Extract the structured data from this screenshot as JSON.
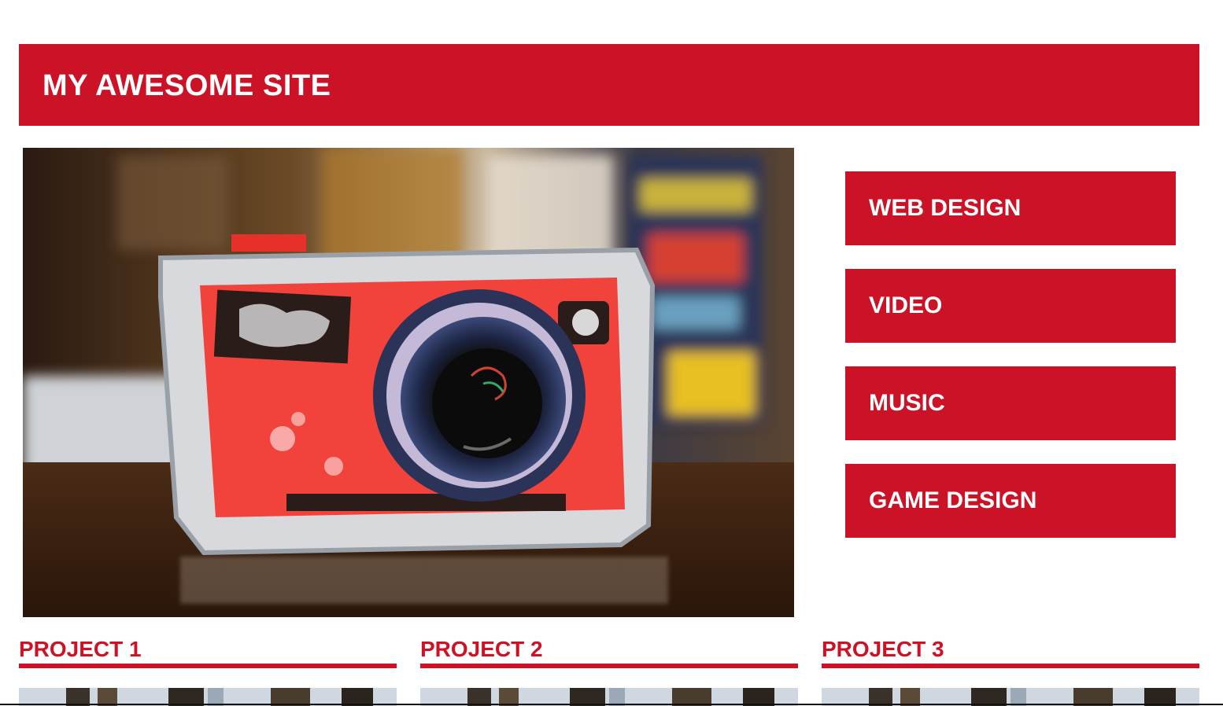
{
  "site": {
    "title": "MY AWESOME SITE"
  },
  "hero_image": {
    "alt": "Handmade red camera sculpture on a wooden table"
  },
  "nav": {
    "items": [
      {
        "label": "WEB DESIGN"
      },
      {
        "label": "VIDEO"
      },
      {
        "label": "MUSIC"
      },
      {
        "label": "GAME DESIGN"
      }
    ]
  },
  "projects": [
    {
      "title": "PROJECT 1"
    },
    {
      "title": "PROJECT 2"
    },
    {
      "title": "PROJECT 3"
    }
  ],
  "colors": {
    "brand_red": "#cb1226",
    "text_on_brand": "#ffffff",
    "background": "#ffffff"
  }
}
